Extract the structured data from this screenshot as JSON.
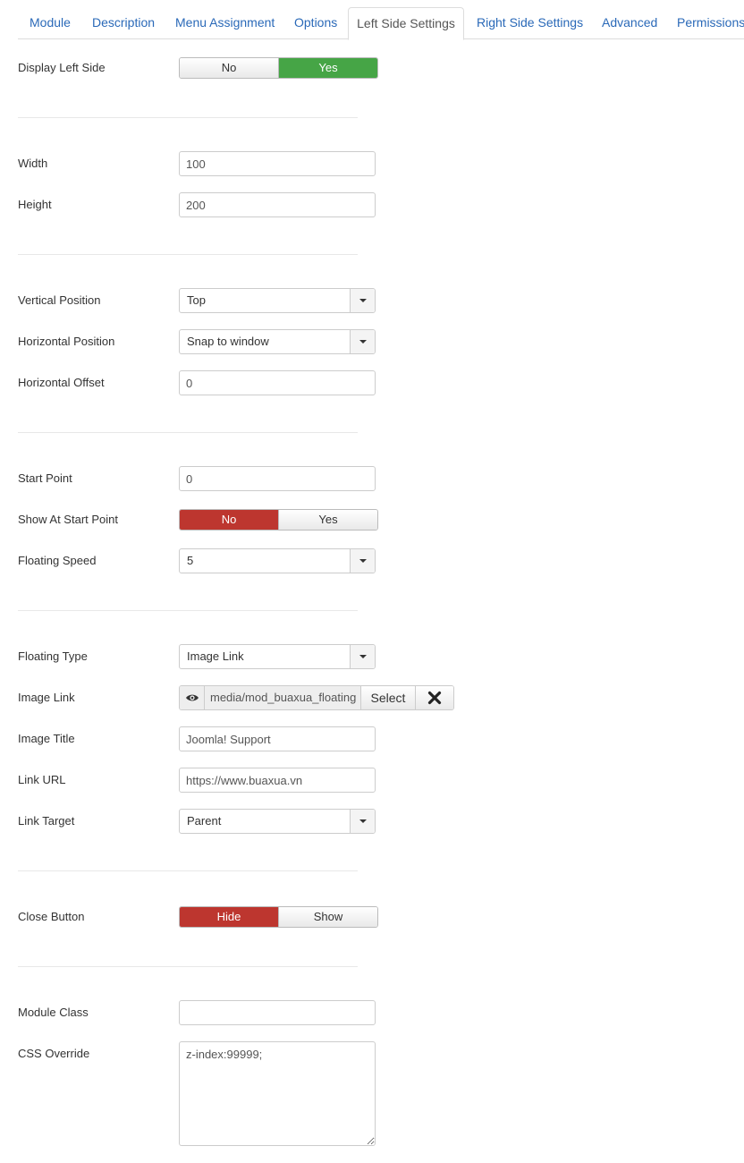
{
  "tabs": [
    {
      "label": "Module"
    },
    {
      "label": "Description"
    },
    {
      "label": "Menu Assignment"
    },
    {
      "label": "Options"
    },
    {
      "label": "Left Side Settings"
    },
    {
      "label": "Right Side Settings"
    },
    {
      "label": "Advanced"
    },
    {
      "label": "Permissions"
    }
  ],
  "active_tab": "Left Side Settings",
  "fields": {
    "display_left_side": {
      "label": "Display Left Side",
      "options": [
        "No",
        "Yes"
      ],
      "selected": "Yes"
    },
    "width": {
      "label": "Width",
      "value": "100"
    },
    "height": {
      "label": "Height",
      "value": "200"
    },
    "vertical_position": {
      "label": "Vertical Position",
      "value": "Top"
    },
    "horizontal_position": {
      "label": "Horizontal Position",
      "value": "Snap to window"
    },
    "horizontal_offset": {
      "label": "Horizontal Offset",
      "value": "0"
    },
    "start_point": {
      "label": "Start Point",
      "value": "0"
    },
    "show_at_start_point": {
      "label": "Show At Start Point",
      "options": [
        "No",
        "Yes"
      ],
      "selected": "No"
    },
    "floating_speed": {
      "label": "Floating Speed",
      "value": "5"
    },
    "floating_type": {
      "label": "Floating Type",
      "value": "Image Link"
    },
    "image_link": {
      "label": "Image Link",
      "value": "media/mod_buaxua_floating",
      "select_label": "Select"
    },
    "image_title": {
      "label": "Image Title",
      "value": "Joomla! Support"
    },
    "link_url": {
      "label": "Link URL",
      "value": "https://www.buaxua.vn"
    },
    "link_target": {
      "label": "Link Target",
      "value": "Parent"
    },
    "close_button": {
      "label": "Close Button",
      "options": [
        "Hide",
        "Show"
      ],
      "selected": "Hide"
    },
    "module_class": {
      "label": "Module Class",
      "value": ""
    },
    "css_override": {
      "label": "CSS Override",
      "value": "z-index:99999;"
    }
  },
  "colors": {
    "link": "#2a69b8",
    "toggle_green": "#46a546",
    "toggle_red": "#bd362f"
  }
}
